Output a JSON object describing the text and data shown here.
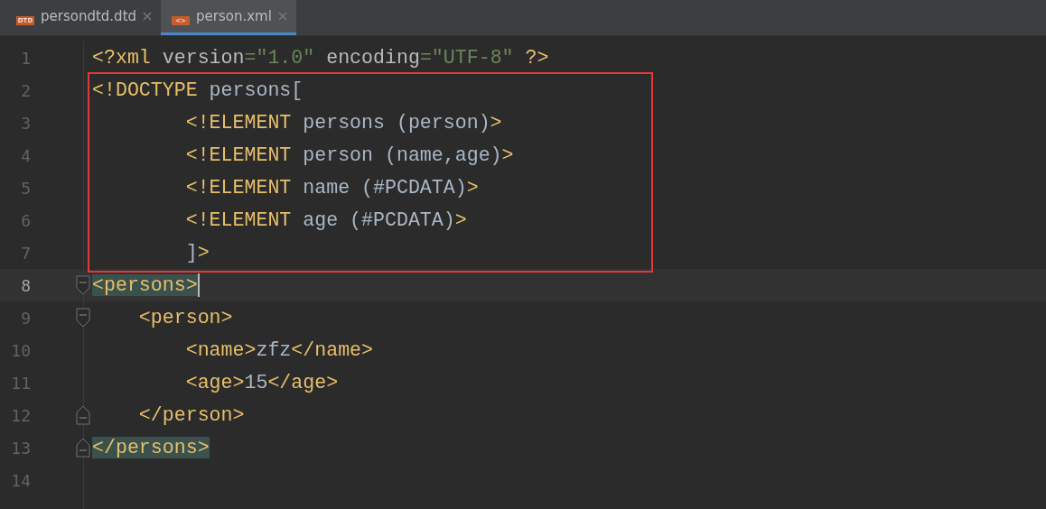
{
  "tabs": [
    {
      "label": "persondtd.dtd",
      "icon_label": "DTD",
      "selected": false
    },
    {
      "label": "person.xml",
      "icon_label": "<>",
      "selected": true
    }
  ],
  "editor": {
    "lines": [
      {
        "number": "1",
        "current": false,
        "framed": false,
        "tokens": [
          {
            "kind": "tag",
            "text": "<?xml "
          },
          {
            "kind": "attr",
            "text": "version"
          },
          {
            "kind": "value",
            "text": "=\"1.0\" "
          },
          {
            "kind": "attr",
            "text": "encoding"
          },
          {
            "kind": "value",
            "text": "=\"UTF-8\" "
          },
          {
            "kind": "tag",
            "text": "?>"
          }
        ]
      },
      {
        "number": "2",
        "current": false,
        "framed": true,
        "tokens": [
          {
            "kind": "tag",
            "text": "<!DOCTYPE "
          },
          {
            "kind": "text",
            "text": "persons["
          }
        ]
      },
      {
        "number": "3",
        "current": false,
        "framed": true,
        "tokens": [
          {
            "kind": "tag",
            "text": "        <!ELEMENT "
          },
          {
            "kind": "text",
            "text": "persons (person)"
          },
          {
            "kind": "tag",
            "text": ">"
          }
        ]
      },
      {
        "number": "4",
        "current": false,
        "framed": true,
        "tokens": [
          {
            "kind": "tag",
            "text": "        <!ELEMENT "
          },
          {
            "kind": "text",
            "text": "person (name,age)"
          },
          {
            "kind": "tag",
            "text": ">"
          }
        ]
      },
      {
        "number": "5",
        "current": false,
        "framed": true,
        "tokens": [
          {
            "kind": "tag",
            "text": "        <!ELEMENT "
          },
          {
            "kind": "text",
            "text": "name (#PCDATA)"
          },
          {
            "kind": "tag",
            "text": ">"
          }
        ]
      },
      {
        "number": "6",
        "current": false,
        "framed": true,
        "tokens": [
          {
            "kind": "tag",
            "text": "        <!ELEMENT "
          },
          {
            "kind": "text",
            "text": "age (#PCDATA)"
          },
          {
            "kind": "tag",
            "text": ">"
          }
        ]
      },
      {
        "number": "7",
        "current": false,
        "framed": true,
        "tokens": [
          {
            "kind": "text",
            "text": "        ]"
          },
          {
            "kind": "tag",
            "text": ">"
          }
        ]
      },
      {
        "number": "8",
        "current": true,
        "framed": false,
        "fold_start": true,
        "tokens": [
          {
            "kind": "tag",
            "text": "<persons>",
            "matched": true
          }
        ]
      },
      {
        "number": "9",
        "current": false,
        "framed": false,
        "fold_start": true,
        "tokens": [
          {
            "kind": "tag",
            "text": "    <person>"
          }
        ]
      },
      {
        "number": "10",
        "current": false,
        "framed": false,
        "tokens": [
          {
            "kind": "tag",
            "text": "        <name>"
          },
          {
            "kind": "text",
            "text": "zfz"
          },
          {
            "kind": "tag",
            "text": "</name>"
          }
        ]
      },
      {
        "number": "11",
        "current": false,
        "framed": false,
        "tokens": [
          {
            "kind": "tag",
            "text": "        <age>"
          },
          {
            "kind": "text",
            "text": "15"
          },
          {
            "kind": "tag",
            "text": "</age>"
          }
        ]
      },
      {
        "number": "12",
        "current": false,
        "framed": false,
        "fold_end": true,
        "tokens": [
          {
            "kind": "tag",
            "text": "    </person>"
          }
        ]
      },
      {
        "number": "13",
        "current": false,
        "framed": false,
        "fold_end": true,
        "tokens": [
          {
            "kind": "tag",
            "text": "</persons>",
            "matched": true
          }
        ]
      },
      {
        "number": "14",
        "current": false,
        "framed": false
      }
    ]
  }
}
